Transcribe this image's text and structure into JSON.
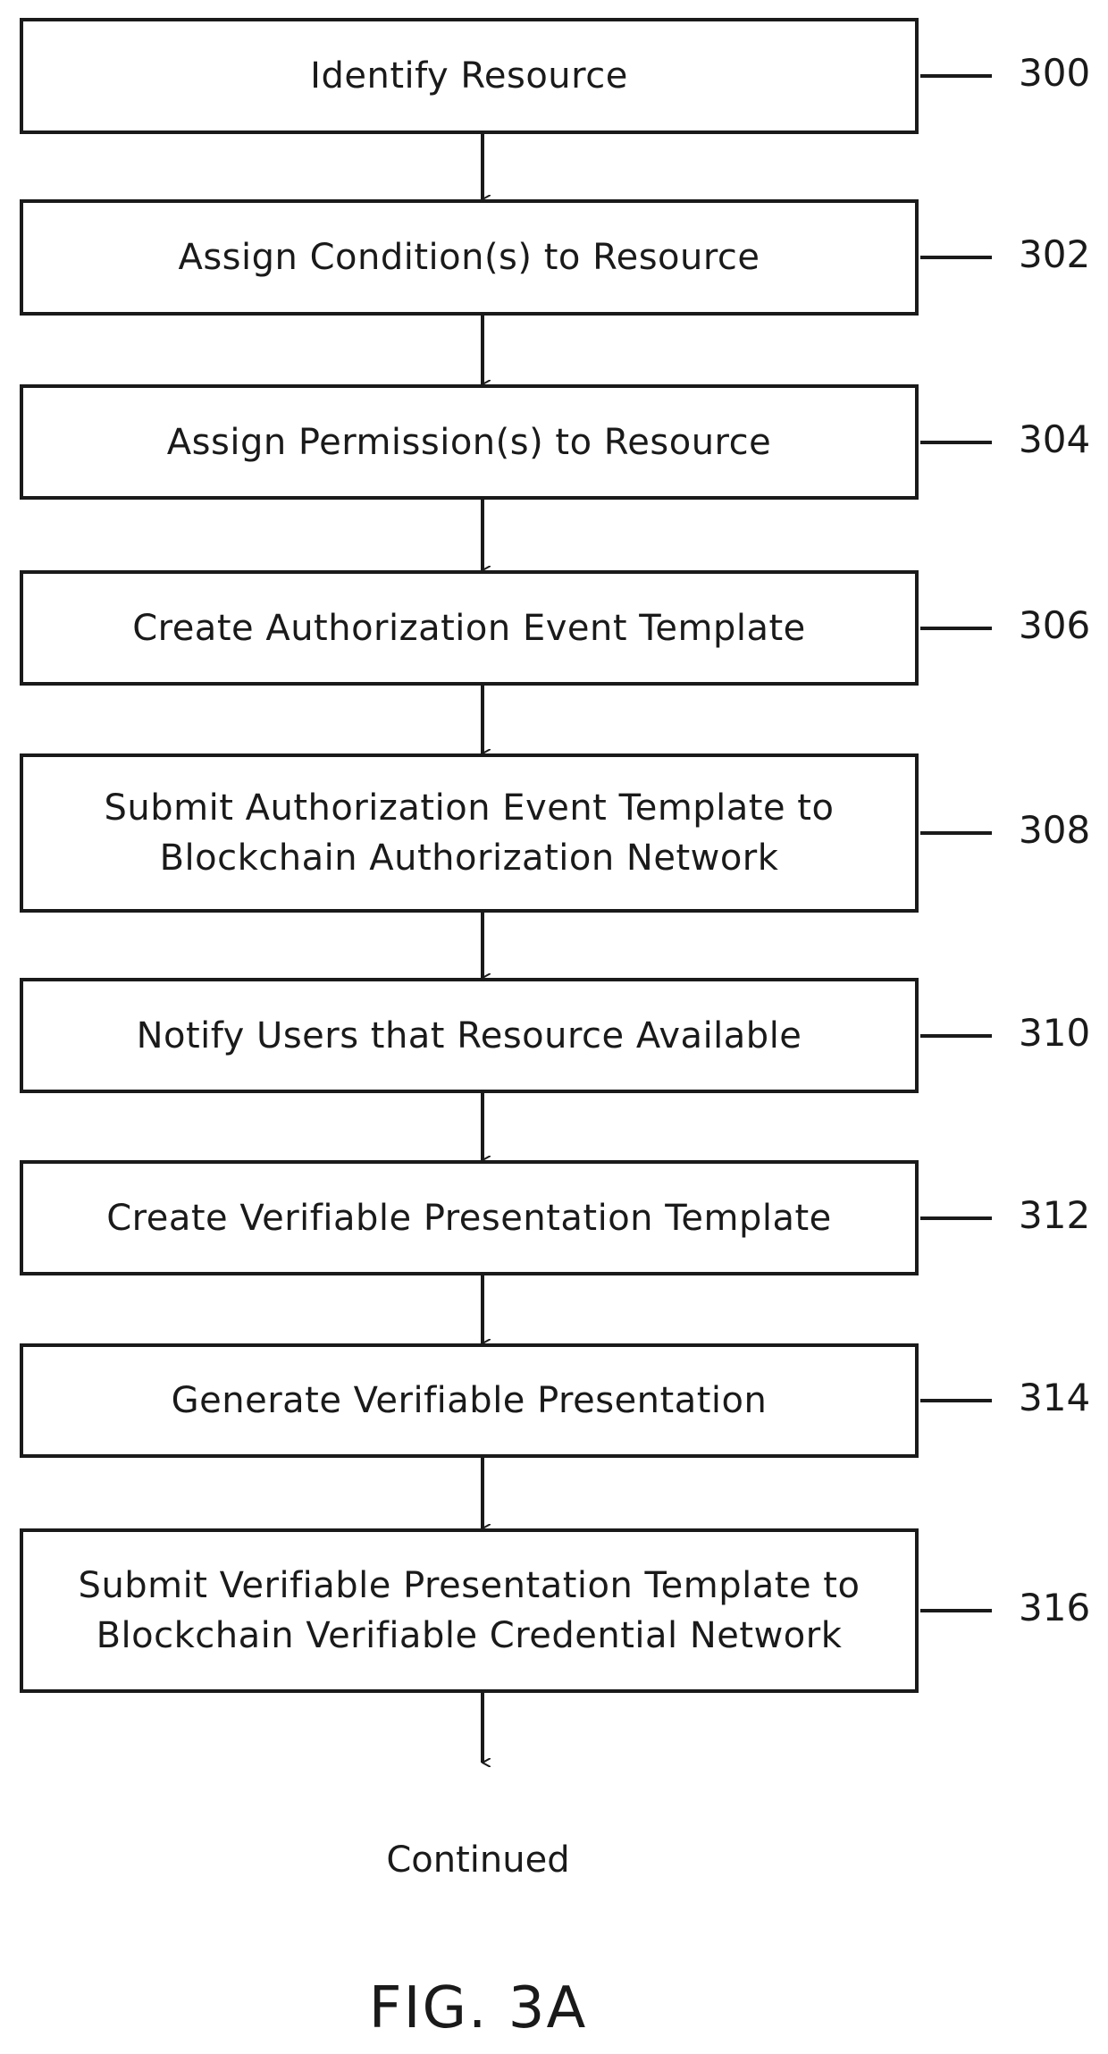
{
  "steps": [
    {
      "text": "Identify Resource",
      "ref": "300"
    },
    {
      "text": "Assign Condition(s) to Resource",
      "ref": "302"
    },
    {
      "text": "Assign Permission(s) to Resource",
      "ref": "304"
    },
    {
      "text": "Create Authorization Event Template",
      "ref": "306"
    },
    {
      "text": "Submit Authorization Event Template to\nBlockchain Authorization Network",
      "ref": "308"
    },
    {
      "text": "Notify Users that Resource Available",
      "ref": "310"
    },
    {
      "text": "Create Verifiable Presentation Template",
      "ref": "312"
    },
    {
      "text": "Generate Verifiable Presentation",
      "ref": "314"
    },
    {
      "text": "Submit Verifiable Presentation Template to\nBlockchain Verifiable Credential Network",
      "ref": "316"
    }
  ],
  "continued_label": "Continued",
  "figure_label": "FIG. 3A"
}
